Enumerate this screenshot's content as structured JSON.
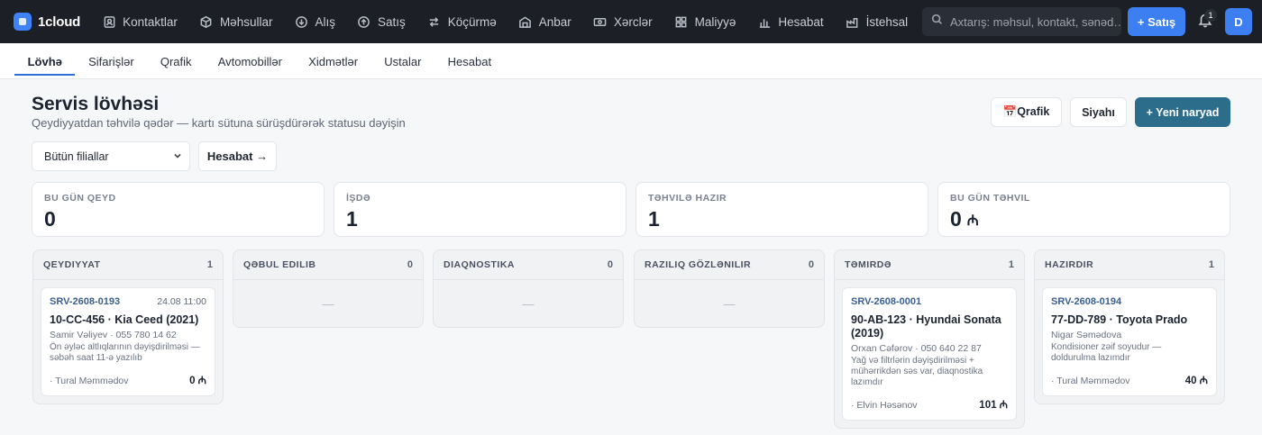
{
  "brand": {
    "name": "1cloud"
  },
  "nav": [
    {
      "label": "Kontaktlar",
      "icon": "contacts-icon"
    },
    {
      "label": "Məhsullar",
      "icon": "box-icon"
    },
    {
      "label": "Alış",
      "icon": "download-circle-icon"
    },
    {
      "label": "Satış",
      "icon": "upload-circle-icon"
    },
    {
      "label": "Köçürmə",
      "icon": "transfer-icon"
    },
    {
      "label": "Anbar",
      "icon": "warehouse-icon"
    },
    {
      "label": "Xərclər",
      "icon": "cash-icon"
    },
    {
      "label": "Maliyyə",
      "icon": "grid-icon"
    },
    {
      "label": "Hesabat",
      "icon": "bar-chart-icon"
    },
    {
      "label": "İstehsal",
      "icon": "factory-icon"
    }
  ],
  "search": {
    "placeholder": "Axtarış: məhsul, kontakt, sənəd…"
  },
  "header_actions": {
    "sale_label": "+ Satış",
    "notif_count": "1",
    "avatar_initial": "D"
  },
  "tabs": [
    {
      "label": "Lövhə",
      "active": true
    },
    {
      "label": "Sifarişlər"
    },
    {
      "label": "Qrafik"
    },
    {
      "label": "Avtomobillər"
    },
    {
      "label": "Xidmətlər"
    },
    {
      "label": "Ustalar"
    },
    {
      "label": "Hesabat"
    }
  ],
  "page": {
    "title": "Servis lövhəsi",
    "subtitle": "Qeydiyyatdan təhvilə qədər — kartı sütuna sürüşdürərək statusu dəyişin",
    "btn_schedule": "📅Qrafik",
    "btn_list": "Siyahı",
    "btn_new": "+ Yeni naryad",
    "branch_select": "Bütün filiallar",
    "report_link": "Hesabat →"
  },
  "stats": [
    {
      "label": "Bu gün qeyd",
      "value": "0",
      "currency": ""
    },
    {
      "label": "İşdə",
      "value": "1",
      "currency": ""
    },
    {
      "label": "Təhvilə hazır",
      "value": "1",
      "currency": ""
    },
    {
      "label": "Bu gün təhvil",
      "value": "0",
      "currency": "₼"
    }
  ],
  "columns": [
    {
      "title": "Qeydiyyat",
      "count": "1",
      "cards": [
        {
          "number": "SRV-2608-0193",
          "date": "24.08 11:00",
          "car": "10-CC-456 · Kia Ceed (2021)",
          "client": "Samir Vəliyev · 055 780 14 62",
          "desc": "Ön əyləc altlıqlarının dəyişdirilməsi — səbəh saat 11-ə yazılıb",
          "master": "· Tural Məmmədov",
          "sum": "0 ₼"
        }
      ]
    },
    {
      "title": "Qəbul edilib",
      "count": "0",
      "empty": "—",
      "cards": []
    },
    {
      "title": "Diaqnostika",
      "count": "0",
      "empty": "—",
      "cards": []
    },
    {
      "title": "Razılıq gözlənilir",
      "count": "0",
      "empty": "—",
      "cards": []
    },
    {
      "title": "Təmirdə",
      "count": "1",
      "cards": [
        {
          "number": "SRV-2608-0001",
          "date": "",
          "car": "90-AB-123 · Hyundai Sonata (2019)",
          "client": "Orxan Cəfərov · 050 640 22 87",
          "desc": "Yağ və filtrlərin dəyişdirilməsi + mühərrikdən səs var, diaqnostika lazımdır",
          "master": "· Elvin Həsənov",
          "sum": "101 ₼"
        }
      ]
    },
    {
      "title": "Hazırdır",
      "count": "1",
      "cards": [
        {
          "number": "SRV-2608-0194",
          "date": "",
          "car": "77-DD-789 · Toyota Prado",
          "client": "Nigar Səmədova",
          "desc": "Kondisioner zəif soyudur — doldurulma lazımdır",
          "master": "· Tural Məmmədov",
          "sum": "40 ₼"
        }
      ]
    }
  ]
}
